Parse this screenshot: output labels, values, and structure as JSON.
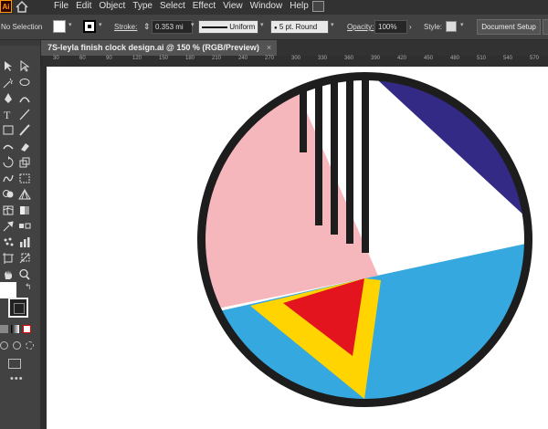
{
  "app": {
    "logo": "Ai"
  },
  "menu": [
    "File",
    "Edit",
    "Object",
    "Type",
    "Select",
    "Effect",
    "View",
    "Window",
    "Help"
  ],
  "control": {
    "selection": "No Selection",
    "stroke_label": "Stroke:",
    "stroke_value": "0.353 mi",
    "profile": "Uniform",
    "brush": "5 pt. Round",
    "opacity_label": "Opacity:",
    "opacity_value": "100%",
    "style_label": "Style:",
    "doc_setup": "Document Setup"
  },
  "document": {
    "tab_title": "7S-leyla finish clock design.ai @ 150 % (RGB/Preview)",
    "close": "×"
  },
  "ruler_ticks": [
    "30",
    "60",
    "90",
    "120",
    "150",
    "180",
    "210",
    "240",
    "270",
    "300",
    "330",
    "360",
    "390",
    "420",
    "450",
    "480",
    "510",
    "540",
    "570"
  ],
  "colors": {
    "navy": "#332a86",
    "pink": "#f5b7bb",
    "red": "#e3141d",
    "yellow": "#ffd400",
    "blue": "#35a8df",
    "outline": "#1d1d1d",
    "stripes": "#1d1d1d"
  },
  "icons": {
    "home": "home-icon",
    "tools": [
      "selection-tool-icon",
      "direct-selection-tool-icon",
      "magic-wand-icon",
      "lasso-icon",
      "pen-tool-icon",
      "curvature-tool-icon",
      "type-tool-icon",
      "line-tool-icon",
      "rectangle-tool-icon",
      "paintbrush-icon",
      "shaper-icon",
      "eraser-icon",
      "rotate-icon",
      "scale-icon",
      "warp-icon",
      "free-transform-icon",
      "shape-builder-icon",
      "perspective-grid-icon",
      "mesh-icon",
      "gradient-icon",
      "eyedropper-icon",
      "blend-icon",
      "symbol-sprayer-icon",
      "column-graph-icon",
      "artboard-icon",
      "slice-icon",
      "hand-tool-icon",
      "zoom-tool-icon"
    ]
  }
}
